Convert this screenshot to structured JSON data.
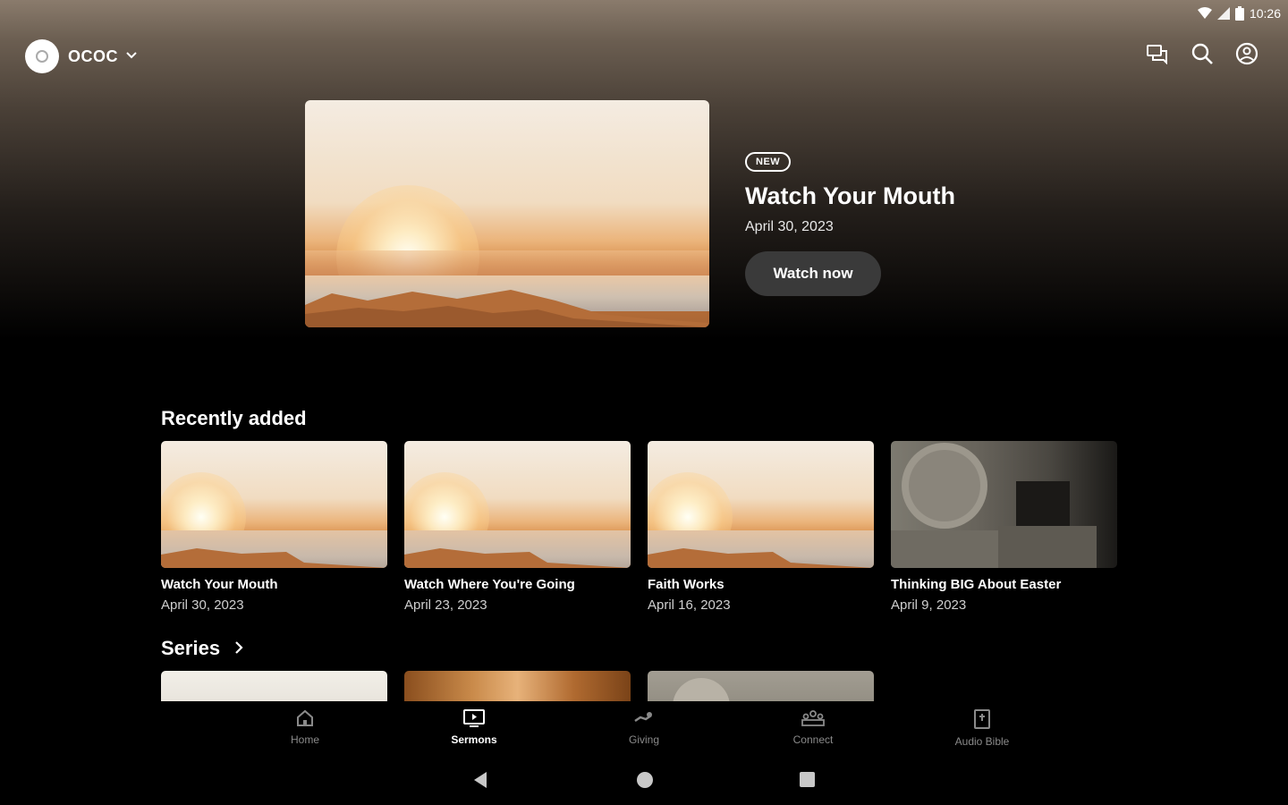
{
  "status_bar": {
    "time": "10:26",
    "icons": [
      "wifi-icon",
      "signal-icon",
      "battery-icon"
    ]
  },
  "header": {
    "org_name": "OCOC",
    "actions": [
      "chat-icon",
      "search-icon",
      "account-icon"
    ]
  },
  "hero": {
    "badge": "NEW",
    "title": "Watch Your Mouth",
    "date": "April 30, 2023",
    "button_label": "Watch now"
  },
  "recently_added": {
    "title": "Recently added",
    "items": [
      {
        "title": "Watch Your Mouth",
        "date": "April 30, 2023",
        "thumbnail": "sunrise"
      },
      {
        "title": "Watch Where You're Going",
        "date": "April 23, 2023",
        "thumbnail": "sunrise"
      },
      {
        "title": "Faith Works",
        "date": "April 16, 2023",
        "thumbnail": "sunrise"
      },
      {
        "title": "Thinking BIG About Easter",
        "date": "April 9, 2023",
        "thumbnail": "tomb"
      }
    ]
  },
  "series": {
    "title": "Series"
  },
  "bottom_nav": {
    "items": [
      {
        "label": "Home",
        "icon": "home-icon",
        "active": false
      },
      {
        "label": "Sermons",
        "icon": "sermons-icon",
        "active": true
      },
      {
        "label": "Giving",
        "icon": "giving-icon",
        "active": false
      },
      {
        "label": "Connect",
        "icon": "connect-icon",
        "active": false
      },
      {
        "label": "Audio Bible",
        "icon": "bible-icon",
        "active": false
      }
    ]
  },
  "colors": {
    "background": "#000000",
    "accent": "#ffffff",
    "button": "#3a3a3a",
    "inactive": "#8a8a8a"
  }
}
